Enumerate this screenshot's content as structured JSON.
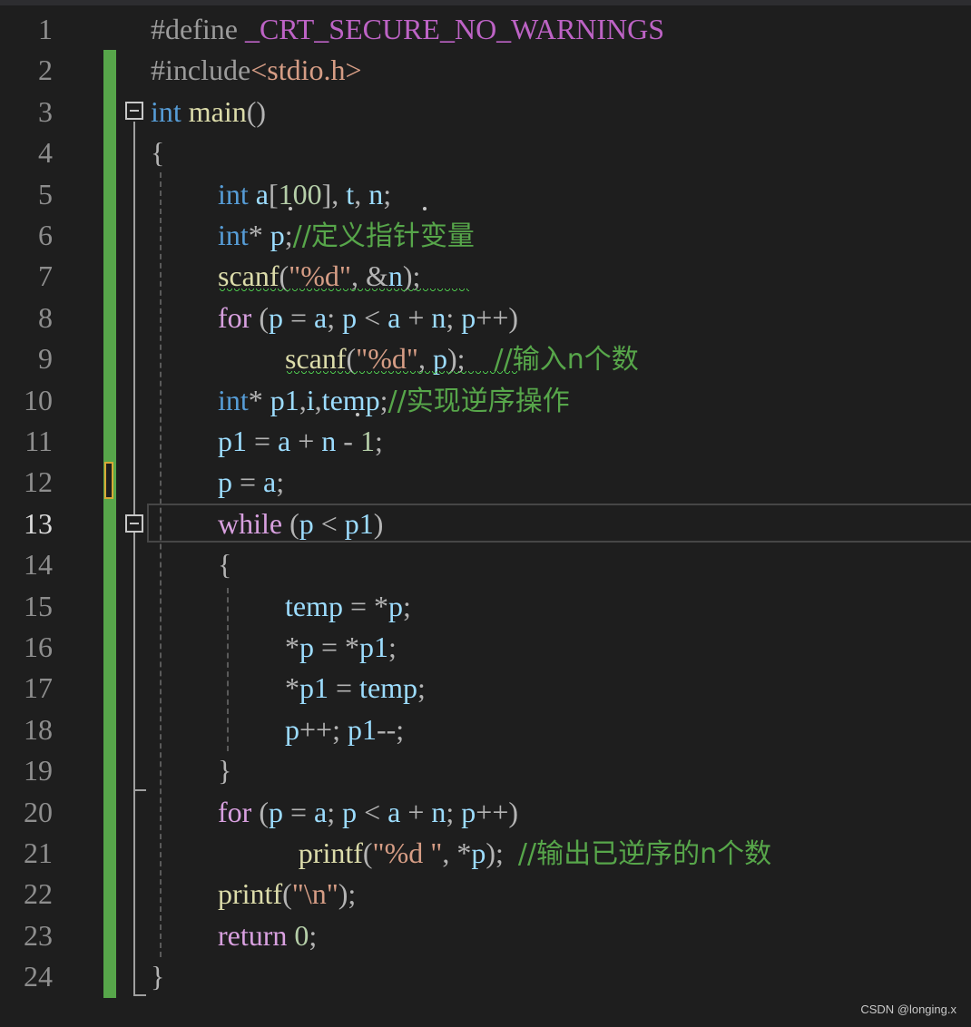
{
  "editor": {
    "line_numbers": [
      "1",
      "2",
      "3",
      "4",
      "5",
      "6",
      "7",
      "8",
      "9",
      "10",
      "11",
      "12",
      "13",
      "14",
      "15",
      "16",
      "17",
      "18",
      "19",
      "20",
      "21",
      "22",
      "23",
      "24"
    ],
    "active_line": 13,
    "lines": [
      {
        "indent": 0,
        "tokens": [
          [
            "pp",
            "#define "
          ],
          [
            "macro",
            "_CRT_SECURE_NO_WARNINGS"
          ]
        ]
      },
      {
        "indent": 0,
        "tokens": [
          [
            "pp",
            "#include"
          ],
          [
            "inc",
            "<stdio.h>"
          ]
        ]
      },
      {
        "indent": 0,
        "tokens": [
          [
            "kw",
            "int"
          ],
          [
            "op",
            " "
          ],
          [
            "fn",
            "main"
          ],
          [
            "op",
            "()"
          ]
        ]
      },
      {
        "indent": 0,
        "tokens": [
          [
            "op",
            "{"
          ]
        ]
      },
      {
        "indent": 1,
        "tokens": [
          [
            "kw",
            "int"
          ],
          [
            "op",
            " "
          ],
          [
            "var",
            "a"
          ],
          [
            "op",
            "["
          ],
          [
            "num",
            "100"
          ],
          [
            "op",
            "], "
          ],
          [
            "var",
            "t"
          ],
          [
            "op",
            ", "
          ],
          [
            "var",
            "n"
          ],
          [
            "op",
            ";"
          ]
        ]
      },
      {
        "indent": 1,
        "tokens": [
          [
            "kw",
            "int"
          ],
          [
            "op",
            "* "
          ],
          [
            "var",
            "p"
          ],
          [
            "op",
            ";"
          ],
          [
            "cm",
            "//定义指针变量"
          ]
        ]
      },
      {
        "indent": 1,
        "tokens": [
          [
            "fn",
            "scanf"
          ],
          [
            "op",
            "("
          ],
          [
            "str",
            "\"%d\""
          ],
          [
            "op",
            ", &"
          ],
          [
            "var",
            "n"
          ],
          [
            "op",
            ");"
          ]
        ]
      },
      {
        "indent": 1,
        "tokens": [
          [
            "ctl",
            "for"
          ],
          [
            "op",
            " ("
          ],
          [
            "var",
            "p"
          ],
          [
            "op",
            " = "
          ],
          [
            "var",
            "a"
          ],
          [
            "op",
            "; "
          ],
          [
            "var",
            "p"
          ],
          [
            "op",
            " < "
          ],
          [
            "var",
            "a"
          ],
          [
            "op",
            " + "
          ],
          [
            "var",
            "n"
          ],
          [
            "op",
            "; "
          ],
          [
            "var",
            "p"
          ],
          [
            "op",
            "++)"
          ]
        ]
      },
      {
        "indent": 2,
        "tokens": [
          [
            "fn",
            "scanf"
          ],
          [
            "op",
            "("
          ],
          [
            "str",
            "\"%d\""
          ],
          [
            "op",
            ", "
          ],
          [
            "var",
            "p"
          ],
          [
            "op",
            ");    "
          ],
          [
            "cm",
            "//输入n个数"
          ]
        ]
      },
      {
        "indent": 1,
        "tokens": [
          [
            "kw",
            "int"
          ],
          [
            "op",
            "* "
          ],
          [
            "var",
            "p1"
          ],
          [
            "op",
            ","
          ],
          [
            "var",
            "i"
          ],
          [
            "op",
            ","
          ],
          [
            "var",
            "temp"
          ],
          [
            "op",
            ";"
          ],
          [
            "cm",
            "//实现逆序操作"
          ]
        ]
      },
      {
        "indent": 1,
        "tokens": [
          [
            "var",
            "p1"
          ],
          [
            "op",
            " = "
          ],
          [
            "var",
            "a"
          ],
          [
            "op",
            " + "
          ],
          [
            "var",
            "n"
          ],
          [
            "op",
            " - "
          ],
          [
            "num",
            "1"
          ],
          [
            "op",
            ";"
          ]
        ]
      },
      {
        "indent": 1,
        "tokens": [
          [
            "var",
            "p"
          ],
          [
            "op",
            " = "
          ],
          [
            "var",
            "a"
          ],
          [
            "op",
            ";"
          ]
        ]
      },
      {
        "indent": 1,
        "tokens": [
          [
            "ctl",
            "while"
          ],
          [
            "op",
            " ("
          ],
          [
            "var",
            "p"
          ],
          [
            "op",
            " < "
          ],
          [
            "var",
            "p1"
          ],
          [
            "op",
            ")"
          ]
        ]
      },
      {
        "indent": 1,
        "tokens": [
          [
            "op",
            "{"
          ]
        ]
      },
      {
        "indent": 2,
        "tokens": [
          [
            "var",
            "temp"
          ],
          [
            "op",
            " = *"
          ],
          [
            "var",
            "p"
          ],
          [
            "op",
            ";"
          ]
        ]
      },
      {
        "indent": 2,
        "tokens": [
          [
            "op",
            "*"
          ],
          [
            "var",
            "p"
          ],
          [
            "op",
            " = *"
          ],
          [
            "var",
            "p1"
          ],
          [
            "op",
            ";"
          ]
        ]
      },
      {
        "indent": 2,
        "tokens": [
          [
            "op",
            "*"
          ],
          [
            "var",
            "p1"
          ],
          [
            "op",
            " = "
          ],
          [
            "var",
            "temp"
          ],
          [
            "op",
            ";"
          ]
        ]
      },
      {
        "indent": 2,
        "tokens": [
          [
            "var",
            "p"
          ],
          [
            "op",
            "++; "
          ],
          [
            "var",
            "p1"
          ],
          [
            "op",
            "--;"
          ]
        ]
      },
      {
        "indent": 1,
        "tokens": [
          [
            "op",
            "}"
          ]
        ]
      },
      {
        "indent": 1,
        "tokens": [
          [
            "ctl",
            "for"
          ],
          [
            "op",
            " ("
          ],
          [
            "var",
            "p"
          ],
          [
            "op",
            " = "
          ],
          [
            "var",
            "a"
          ],
          [
            "op",
            "; "
          ],
          [
            "var",
            "p"
          ],
          [
            "op",
            " < "
          ],
          [
            "var",
            "a"
          ],
          [
            "op",
            " + "
          ],
          [
            "var",
            "n"
          ],
          [
            "op",
            "; "
          ],
          [
            "var",
            "p"
          ],
          [
            "op",
            "++)"
          ]
        ]
      },
      {
        "indent": 2.2,
        "tokens": [
          [
            "fn",
            "printf"
          ],
          [
            "op",
            "("
          ],
          [
            "str",
            "\"%d \""
          ],
          [
            "op",
            ", *"
          ],
          [
            "var",
            "p"
          ],
          [
            "op",
            ");  "
          ],
          [
            "cm",
            "//输出已逆序的n个数"
          ]
        ]
      },
      {
        "indent": 1,
        "tokens": [
          [
            "fn",
            "printf"
          ],
          [
            "op",
            "("
          ],
          [
            "str",
            "\"\\n\""
          ],
          [
            "op",
            ");"
          ]
        ]
      },
      {
        "indent": 1,
        "tokens": [
          [
            "ctl",
            "return"
          ],
          [
            "op",
            " "
          ],
          [
            "num",
            "0"
          ],
          [
            "op",
            ";"
          ]
        ]
      },
      {
        "indent": 0,
        "tokens": [
          [
            "op",
            "}"
          ]
        ]
      }
    ]
  },
  "watermark": "CSDN @longing.x",
  "colors": {
    "background": "#1e1e1e",
    "change_bar": "#57a64a",
    "keyword": "#569cd6",
    "control": "#d8a0df",
    "function": "#dcdcaa",
    "variable": "#9cdcfe",
    "string": "#d69d85",
    "number": "#b5cea8",
    "comment": "#57a64a"
  }
}
